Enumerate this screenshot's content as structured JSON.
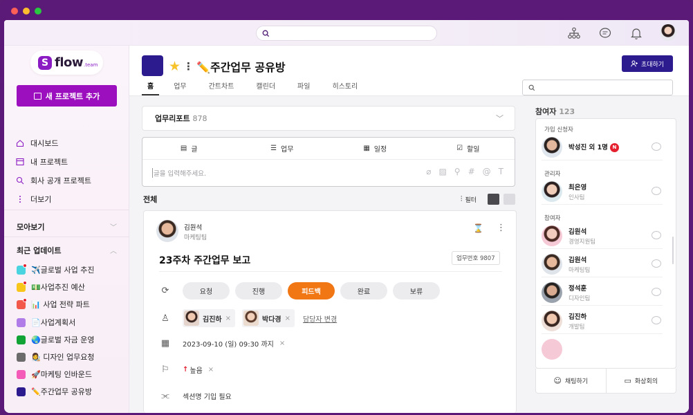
{
  "window": {
    "traffic": [
      "#fe5f57",
      "#febc2e",
      "#28c840"
    ]
  },
  "topbar": {
    "search_placeholder": "",
    "icons": [
      "org-chart-icon",
      "chat-icon",
      "bell-icon"
    ]
  },
  "sidebar": {
    "logo_text": "flow",
    "logo_sub": ".team",
    "logo_mark": "S",
    "new_project": "새 프로젝트 추가",
    "nav": [
      {
        "label": "대시보드",
        "icon": "home-icon"
      },
      {
        "label": "내 프로젝트",
        "icon": "folder-icon"
      },
      {
        "label": "회사 공개 프로젝트",
        "icon": "search-icon"
      },
      {
        "label": "더보기",
        "icon": "more-vertical-icon"
      }
    ],
    "collect_header": "모아보기",
    "recent_header": "최근 업데이트",
    "projects": [
      {
        "label": "✈️글로벌 사업 추진",
        "color": "#4ad4e0",
        "dot": true
      },
      {
        "label": "💵사업추진 예산",
        "color": "#f8c51b",
        "dot": true
      },
      {
        "label": "📊 사업 전략 파트",
        "color": "#f2594b",
        "dot": true
      },
      {
        "label": "📄사업계획서",
        "color": "#b07ce8",
        "dot": false
      },
      {
        "label": "🌏글로벌 자금 운영",
        "color": "#12a336",
        "dot": false
      },
      {
        "label": "👩‍🎨 디자인 업무요청",
        "color": "#6b6b6b",
        "dot": false
      },
      {
        "label": "🚀마케팅 인바운드",
        "color": "#f45ab7",
        "dot": false
      },
      {
        "label": "✏️주간업무 공유방",
        "color": "#2b1b8f",
        "dot": false
      }
    ]
  },
  "project": {
    "title": "✏️주간업무 공유방",
    "color": "#2b1b8f",
    "invite": "초대하기",
    "tabs": [
      "홈",
      "업무",
      "간트차트",
      "캘린더",
      "파일",
      "히스토리"
    ],
    "active_tab": "홈",
    "report_label": "업무리포트",
    "report_count": "878",
    "composer": {
      "tabs": [
        "글",
        "업무",
        "일정",
        "할일"
      ],
      "placeholder": "글을 입력해주세요."
    },
    "all_label": "전체",
    "filter_label": "필터"
  },
  "post": {
    "author": "김원석",
    "team": "마케팅팀",
    "title": "23주차 주간업무 보고",
    "task_no": "업무번호 9807",
    "statuses": [
      "요청",
      "진행",
      "피드백",
      "완료",
      "보류"
    ],
    "active_status": "피드백",
    "assignees": [
      "김진하",
      "박다경"
    ],
    "change_assignee": "담당자 변경",
    "date": "2023-09-10 (일) 09:30 까지",
    "priority": "높음",
    "section": "섹션명 기입 필요"
  },
  "participants": {
    "label": "참여자",
    "count": "123",
    "sections": {
      "request": "가입 신청자",
      "admin": "관리자",
      "member": "참여자"
    },
    "request": [
      {
        "name": "박성진 외 1명",
        "team": "",
        "badge": "N"
      }
    ],
    "admins": [
      {
        "name": "최은영",
        "team": "인사팀"
      }
    ],
    "members": [
      {
        "name": "김원석",
        "team": "경영지원팀"
      },
      {
        "name": "김원석",
        "team": "마케팅팀"
      },
      {
        "name": "정석훈",
        "team": "디자인팀"
      },
      {
        "name": "김진하",
        "team": "개발팀"
      }
    ],
    "chat": "채팅하기",
    "video": "화상회의"
  }
}
